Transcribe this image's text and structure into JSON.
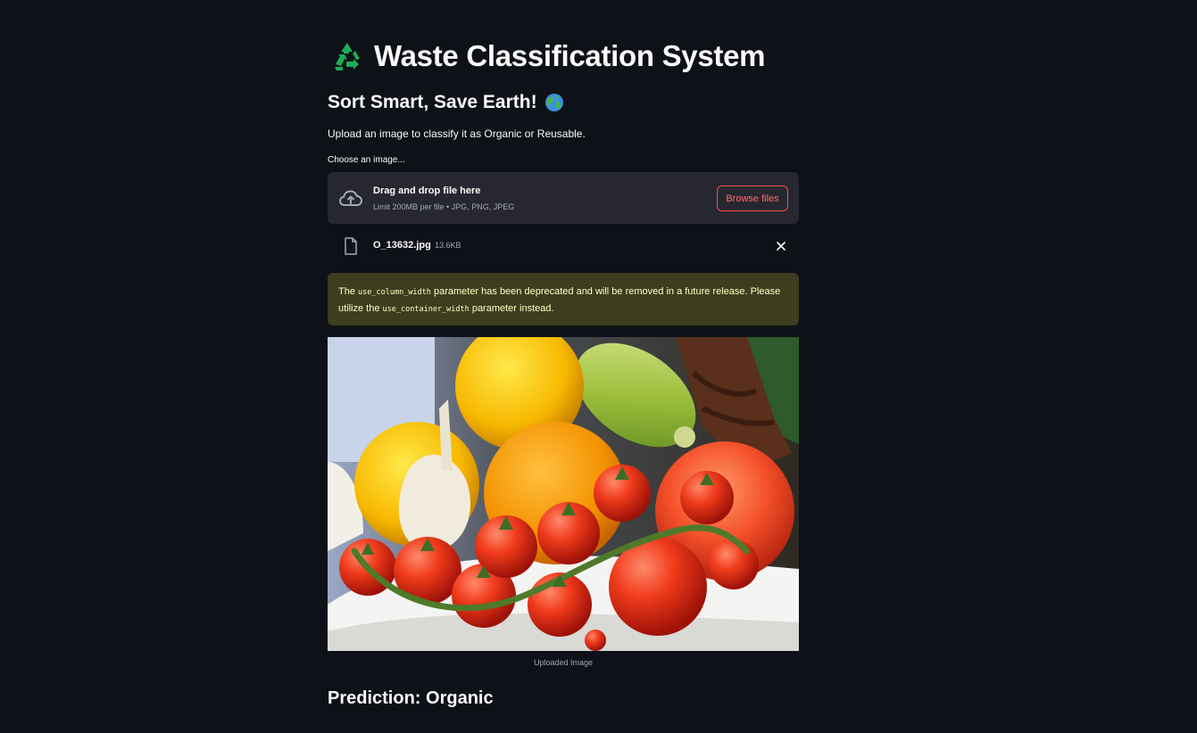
{
  "header": {
    "title_icon": "recycle-icon",
    "title": "Waste Classification System",
    "subtitle": "Sort Smart, Save Earth!",
    "subtitle_icon": "globe-icon"
  },
  "intro_text": "Upload an image to classify it as Organic or Reusable.",
  "uploader": {
    "label": "Choose an image...",
    "drop_title": "Drag and drop file here",
    "limit_text": "Limit 200MB per file • JPG, PNG, JPEG",
    "browse_label": "Browse files",
    "accent_color": "#ff4b4b"
  },
  "uploaded_file": {
    "name": "O_13632.jpg",
    "size": "13.6KB"
  },
  "warning": {
    "part1": "The ",
    "code1": "use_column_width",
    "part2": " parameter has been deprecated and will be removed in a future release. Please utilize the ",
    "code2": "use_container_width",
    "part3": " parameter instead."
  },
  "image": {
    "caption": "Uploaded Image",
    "subject": "bowl of tomatoes, lemons, garlic and zucchini"
  },
  "result": {
    "prediction": "Prediction: Organic"
  }
}
